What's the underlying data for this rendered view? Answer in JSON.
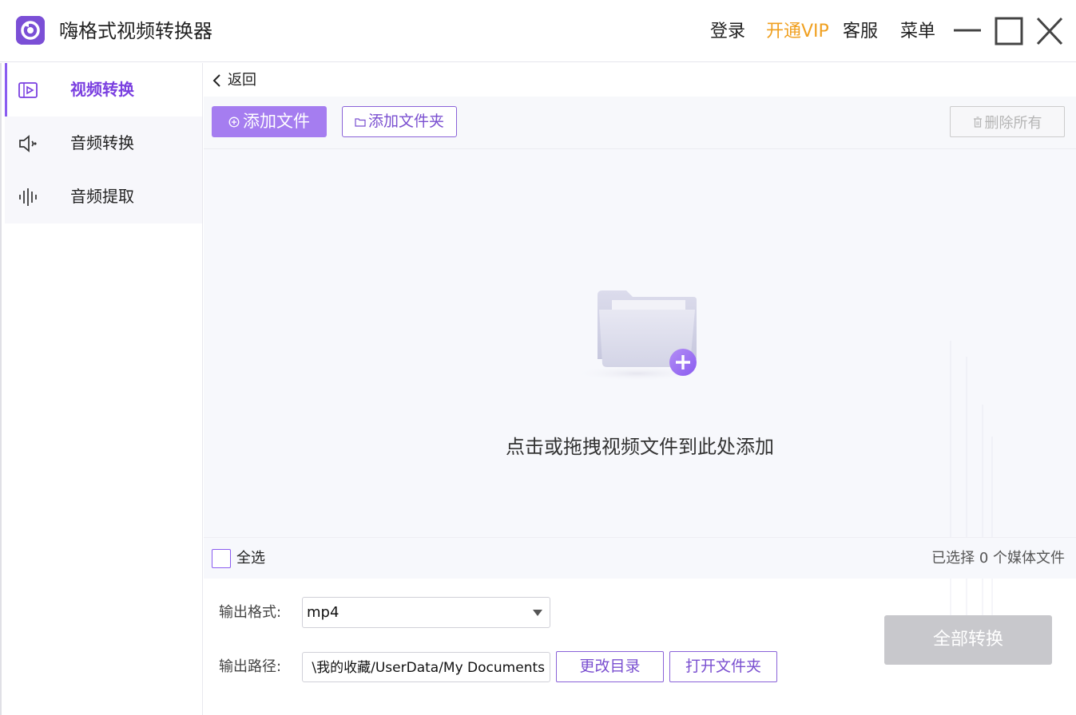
{
  "app": {
    "title": "嗨格式视频转换器",
    "accent_color": "#8a5cf0",
    "vip_color": "#f0a020"
  },
  "header": {
    "login_label": "登录",
    "vip_label": "开通VIP",
    "support_label": "客服",
    "menu_label": "菜单",
    "window_icons": [
      "minimize-icon",
      "maximize-icon",
      "close-icon"
    ]
  },
  "sidebar": {
    "items": [
      {
        "label": "视频转换",
        "icon": "video-convert-icon",
        "active": true
      },
      {
        "label": "音频转换",
        "icon": "speaker-icon",
        "active": false
      },
      {
        "label": "音频提取",
        "icon": "waveform-icon",
        "active": false
      }
    ]
  },
  "main": {
    "back_label": "返回",
    "toolbar": {
      "add_file_label": "添加文件",
      "add_folder_label": "添加文件夹",
      "delete_all_label": "删除所有"
    },
    "dropzone": {
      "hint": "点击或拖拽视频文件到此处添加"
    },
    "selection": {
      "select_all_label": "全选",
      "selected_count_text": "已选择 0 个媒体文件"
    },
    "output": {
      "format_label": "输出格式:",
      "format_value": "mp4",
      "path_label": "输出路径:",
      "path_value": "\\我的收藏/UserData/My Documents",
      "change_dir_label": "更改目录",
      "open_folder_label": "打开文件夹",
      "convert_all_label": "全部转换"
    }
  }
}
